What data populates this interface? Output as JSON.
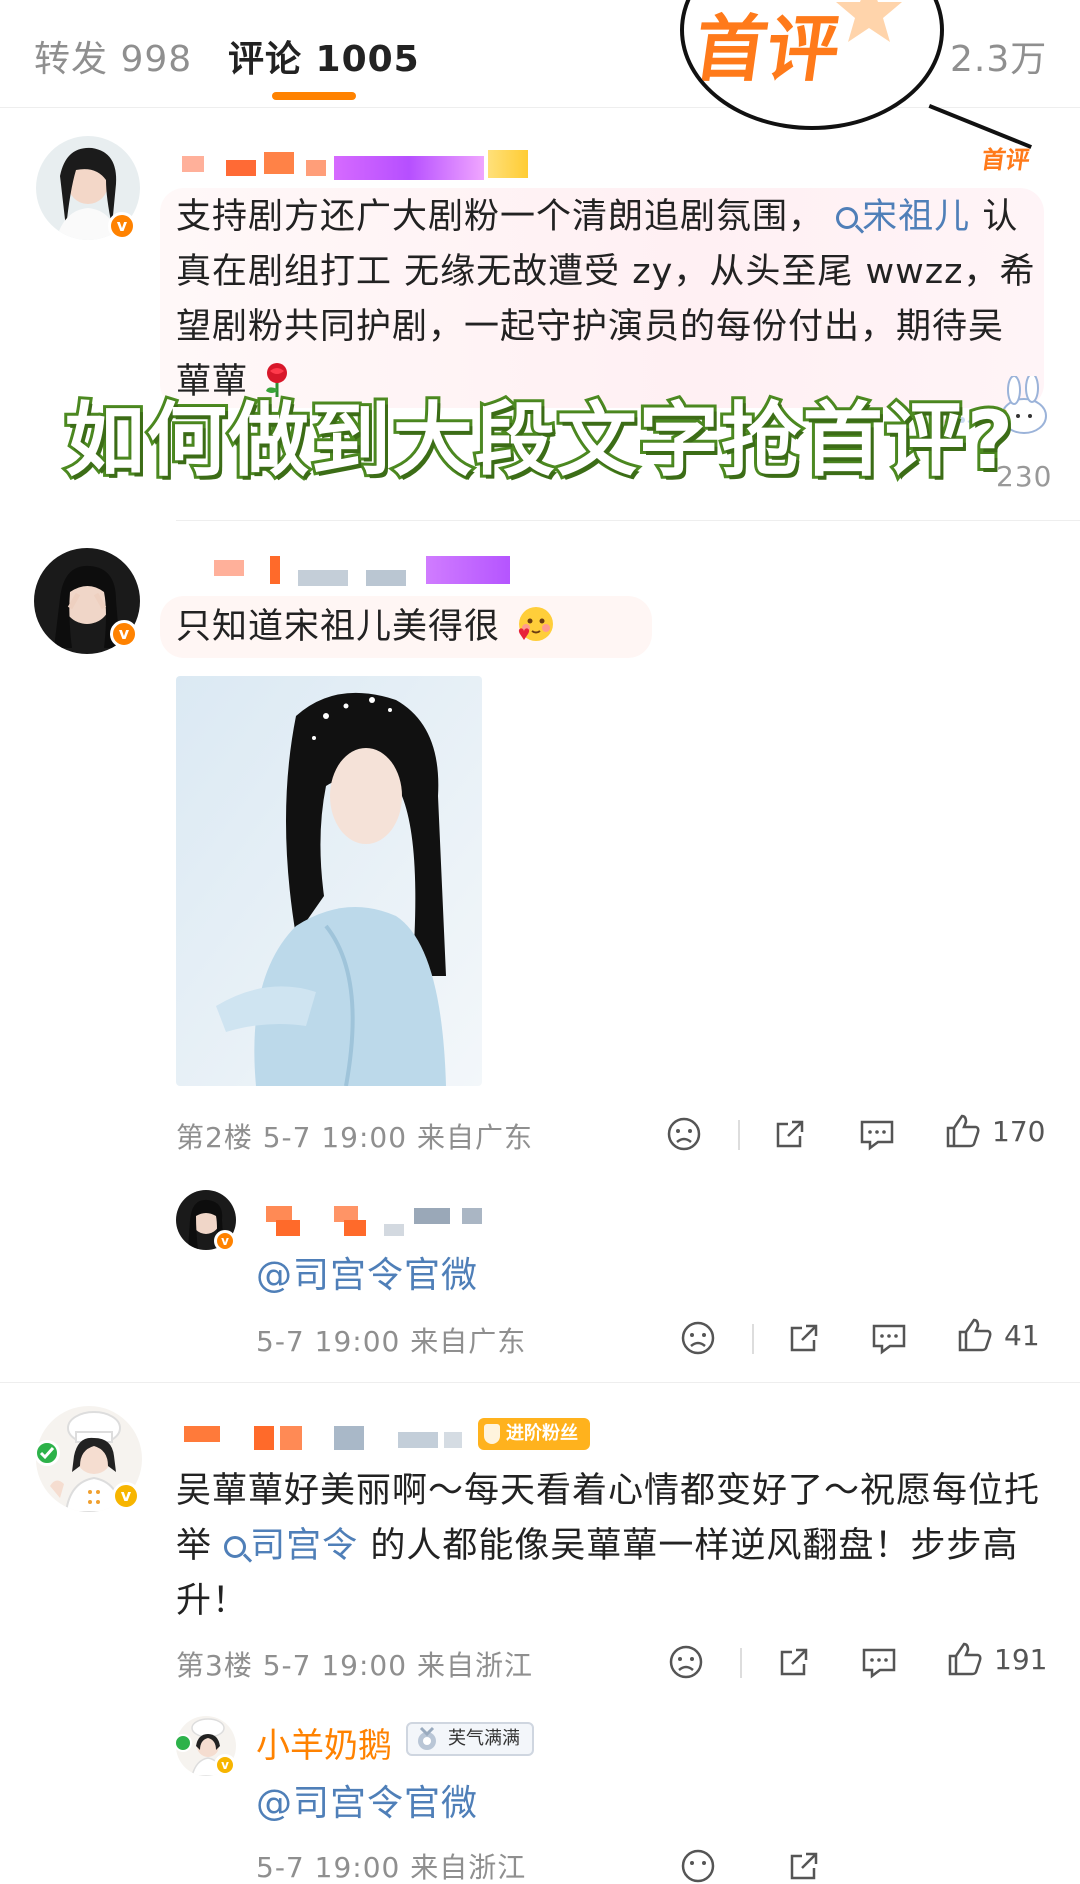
{
  "tabs": {
    "repost": "转发 998",
    "comment": "评论 1005",
    "likes": "2.3万"
  },
  "first_badge": "首评",
  "overlay_title": "如何做到大段文字抢首评?",
  "comments": [
    {
      "text_before": "支持剧方还广大剧粉一个清朗追剧氛围，",
      "mention": "宋祖儿",
      "text_after": "认真在剧组打工 无缘无故遭受 zy，从头至尾 wwzz，希望剧粉共同护剧，一起守护演员的每份付出，期待吴蕇蕇",
      "emoji": "rose-emoji",
      "partial_count": "230"
    },
    {
      "text": "只知道宋祖儿美得很",
      "emoji": "smitten-emoji",
      "meta": "第2楼 5-7 19:00 来自广东",
      "likes": "170",
      "reply": {
        "mention": "@司宫令官微",
        "meta": "5-7 19:00 来自广东",
        "likes": "41"
      }
    },
    {
      "badge": "进阶粉丝",
      "text_before": "吴蕇蕇好美丽啊～每天看着心情都变好了～祝愿每位托举",
      "mention": "司宫令",
      "text_after": "的人都能像吴蕇蕇一样逆风翻盘！步步高升！",
      "meta": "第3楼 5-7 19:00 来自浙江",
      "likes": "191",
      "reply": {
        "name": "小羊奶鹅",
        "badge": "芙气满满",
        "mention": "@司宫令官微",
        "meta": "5-7 19:00 来自浙江"
      }
    }
  ],
  "colors": {
    "accent": "#ff8200",
    "link": "#4f7fb8",
    "meta": "#8f8f8f",
    "overlay_stroke": "#4e8c22"
  }
}
